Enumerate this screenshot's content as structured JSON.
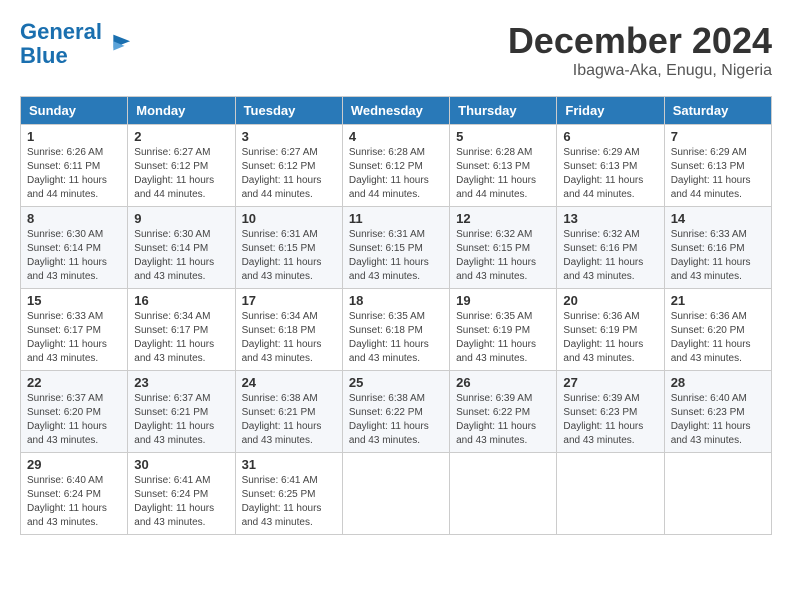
{
  "header": {
    "logo_line1": "General",
    "logo_line2": "Blue",
    "month": "December 2024",
    "location": "Ibagwa-Aka, Enugu, Nigeria"
  },
  "days_of_week": [
    "Sunday",
    "Monday",
    "Tuesday",
    "Wednesday",
    "Thursday",
    "Friday",
    "Saturday"
  ],
  "weeks": [
    [
      {
        "day": "1",
        "info": "Sunrise: 6:26 AM\nSunset: 6:11 PM\nDaylight: 11 hours and 44 minutes."
      },
      {
        "day": "2",
        "info": "Sunrise: 6:27 AM\nSunset: 6:12 PM\nDaylight: 11 hours and 44 minutes."
      },
      {
        "day": "3",
        "info": "Sunrise: 6:27 AM\nSunset: 6:12 PM\nDaylight: 11 hours and 44 minutes."
      },
      {
        "day": "4",
        "info": "Sunrise: 6:28 AM\nSunset: 6:12 PM\nDaylight: 11 hours and 44 minutes."
      },
      {
        "day": "5",
        "info": "Sunrise: 6:28 AM\nSunset: 6:13 PM\nDaylight: 11 hours and 44 minutes."
      },
      {
        "day": "6",
        "info": "Sunrise: 6:29 AM\nSunset: 6:13 PM\nDaylight: 11 hours and 44 minutes."
      },
      {
        "day": "7",
        "info": "Sunrise: 6:29 AM\nSunset: 6:13 PM\nDaylight: 11 hours and 44 minutes."
      }
    ],
    [
      {
        "day": "8",
        "info": "Sunrise: 6:30 AM\nSunset: 6:14 PM\nDaylight: 11 hours and 43 minutes."
      },
      {
        "day": "9",
        "info": "Sunrise: 6:30 AM\nSunset: 6:14 PM\nDaylight: 11 hours and 43 minutes."
      },
      {
        "day": "10",
        "info": "Sunrise: 6:31 AM\nSunset: 6:15 PM\nDaylight: 11 hours and 43 minutes."
      },
      {
        "day": "11",
        "info": "Sunrise: 6:31 AM\nSunset: 6:15 PM\nDaylight: 11 hours and 43 minutes."
      },
      {
        "day": "12",
        "info": "Sunrise: 6:32 AM\nSunset: 6:15 PM\nDaylight: 11 hours and 43 minutes."
      },
      {
        "day": "13",
        "info": "Sunrise: 6:32 AM\nSunset: 6:16 PM\nDaylight: 11 hours and 43 minutes."
      },
      {
        "day": "14",
        "info": "Sunrise: 6:33 AM\nSunset: 6:16 PM\nDaylight: 11 hours and 43 minutes."
      }
    ],
    [
      {
        "day": "15",
        "info": "Sunrise: 6:33 AM\nSunset: 6:17 PM\nDaylight: 11 hours and 43 minutes."
      },
      {
        "day": "16",
        "info": "Sunrise: 6:34 AM\nSunset: 6:17 PM\nDaylight: 11 hours and 43 minutes."
      },
      {
        "day": "17",
        "info": "Sunrise: 6:34 AM\nSunset: 6:18 PM\nDaylight: 11 hours and 43 minutes."
      },
      {
        "day": "18",
        "info": "Sunrise: 6:35 AM\nSunset: 6:18 PM\nDaylight: 11 hours and 43 minutes."
      },
      {
        "day": "19",
        "info": "Sunrise: 6:35 AM\nSunset: 6:19 PM\nDaylight: 11 hours and 43 minutes."
      },
      {
        "day": "20",
        "info": "Sunrise: 6:36 AM\nSunset: 6:19 PM\nDaylight: 11 hours and 43 minutes."
      },
      {
        "day": "21",
        "info": "Sunrise: 6:36 AM\nSunset: 6:20 PM\nDaylight: 11 hours and 43 minutes."
      }
    ],
    [
      {
        "day": "22",
        "info": "Sunrise: 6:37 AM\nSunset: 6:20 PM\nDaylight: 11 hours and 43 minutes."
      },
      {
        "day": "23",
        "info": "Sunrise: 6:37 AM\nSunset: 6:21 PM\nDaylight: 11 hours and 43 minutes."
      },
      {
        "day": "24",
        "info": "Sunrise: 6:38 AM\nSunset: 6:21 PM\nDaylight: 11 hours and 43 minutes."
      },
      {
        "day": "25",
        "info": "Sunrise: 6:38 AM\nSunset: 6:22 PM\nDaylight: 11 hours and 43 minutes."
      },
      {
        "day": "26",
        "info": "Sunrise: 6:39 AM\nSunset: 6:22 PM\nDaylight: 11 hours and 43 minutes."
      },
      {
        "day": "27",
        "info": "Sunrise: 6:39 AM\nSunset: 6:23 PM\nDaylight: 11 hours and 43 minutes."
      },
      {
        "day": "28",
        "info": "Sunrise: 6:40 AM\nSunset: 6:23 PM\nDaylight: 11 hours and 43 minutes."
      }
    ],
    [
      {
        "day": "29",
        "info": "Sunrise: 6:40 AM\nSunset: 6:24 PM\nDaylight: 11 hours and 43 minutes."
      },
      {
        "day": "30",
        "info": "Sunrise: 6:41 AM\nSunset: 6:24 PM\nDaylight: 11 hours and 43 minutes."
      },
      {
        "day": "31",
        "info": "Sunrise: 6:41 AM\nSunset: 6:25 PM\nDaylight: 11 hours and 43 minutes."
      },
      {
        "day": "",
        "info": ""
      },
      {
        "day": "",
        "info": ""
      },
      {
        "day": "",
        "info": ""
      },
      {
        "day": "",
        "info": ""
      }
    ]
  ]
}
